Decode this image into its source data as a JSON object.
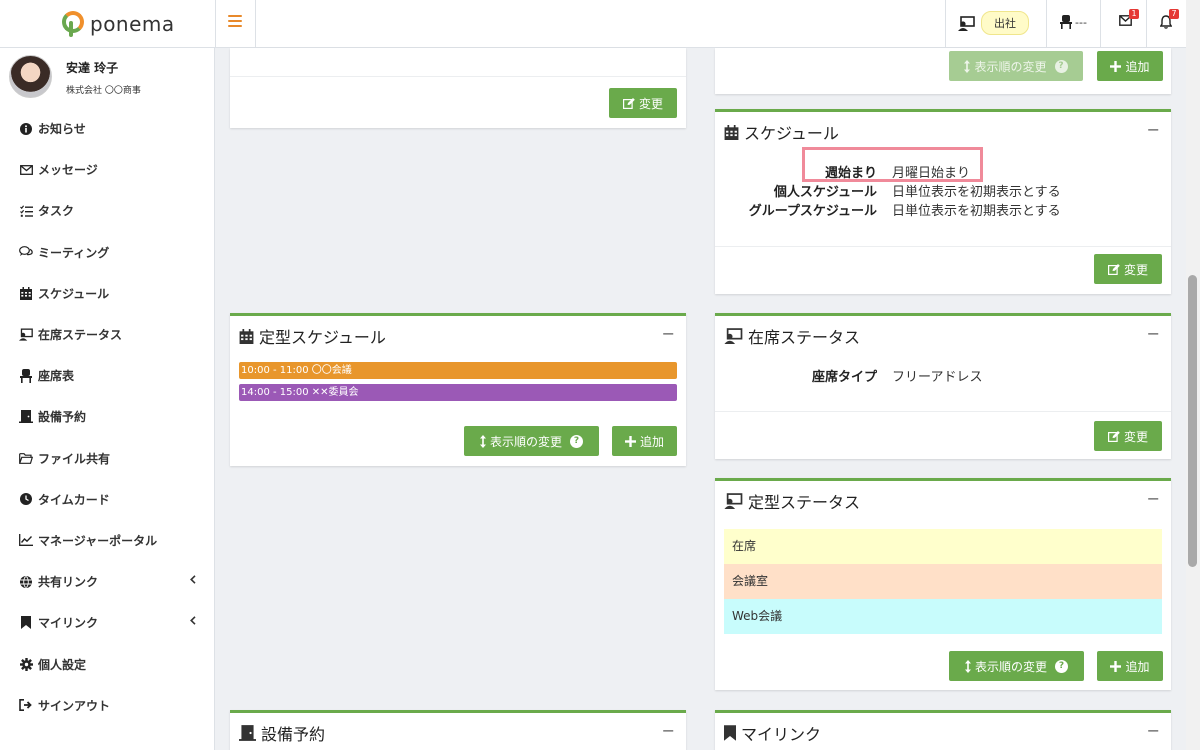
{
  "app": {
    "name": "ponema"
  },
  "topbar": {
    "attendance_label": "出社",
    "seat_label": "---",
    "mail_count": "1",
    "notification_count": "7",
    "icons": [
      "menu-icon",
      "attendance-icon",
      "seat-icon",
      "mail-icon",
      "bell-icon"
    ]
  },
  "user": {
    "name": "安達 玲子",
    "company": "株式会社 〇〇商事"
  },
  "sidebar": {
    "items": [
      {
        "label": "お知らせ",
        "icon": "info-icon"
      },
      {
        "label": "メッセージ",
        "icon": "envelope-icon"
      },
      {
        "label": "タスク",
        "icon": "checklist-icon"
      },
      {
        "label": "ミーティング",
        "icon": "chat-icon"
      },
      {
        "label": "スケジュール",
        "icon": "calendar-icon"
      },
      {
        "label": "在席ステータス",
        "icon": "attendance-icon"
      },
      {
        "label": "座席表",
        "icon": "chair-icon"
      },
      {
        "label": "設備予約",
        "icon": "door-icon"
      },
      {
        "label": "ファイル共有",
        "icon": "folder-icon"
      },
      {
        "label": "タイムカード",
        "icon": "clock-icon"
      },
      {
        "label": "マネージャーポータル",
        "icon": "chart-icon"
      },
      {
        "label": "共有リンク",
        "icon": "globe-icon",
        "has_submenu": true
      },
      {
        "label": "マイリンク",
        "icon": "bookmark-icon",
        "has_submenu": true
      },
      {
        "label": "個人設定",
        "icon": "cog-icon"
      },
      {
        "label": "サインアウト",
        "icon": "signout-icon"
      }
    ]
  },
  "panels": {
    "top_left": {
      "edit_label": "変更"
    },
    "top_right": {
      "reorder_label": "表示順の変更",
      "add_label": "追加"
    },
    "schedule": {
      "title": "スケジュール",
      "rows": [
        {
          "key": "週始まり",
          "value": "月曜日始まり"
        },
        {
          "key": "個人スケジュール",
          "value": "日単位表示を初期表示とする"
        },
        {
          "key": "グループスケジュール",
          "value": "日単位表示を初期表示とする"
        }
      ],
      "edit_label": "変更"
    },
    "fixed_schedule": {
      "title": "定型スケジュール",
      "entries": [
        {
          "text": "10:00 - 11:00  〇〇会議",
          "color": "#e8962c"
        },
        {
          "text": "14:00 - 15:00  ✕✕委員会",
          "color": "#9b59b6"
        }
      ],
      "reorder_label": "表示順の変更",
      "add_label": "追加"
    },
    "presence": {
      "title": "在席ステータス",
      "rows": [
        {
          "key": "座席タイプ",
          "value": "フリーアドレス"
        }
      ],
      "edit_label": "変更"
    },
    "fixed_status": {
      "title": "定型ステータス",
      "entries": [
        {
          "label": "在席",
          "color": "#ffffcc"
        },
        {
          "label": "会議室",
          "color": "#ffe0c8"
        },
        {
          "label": "Web会議",
          "color": "#c8fcfc"
        }
      ],
      "reorder_label": "表示順の変更",
      "add_label": "追加"
    },
    "facility": {
      "title": "設備予約"
    },
    "mylink": {
      "title": "マイリンク"
    }
  },
  "colors": {
    "accent": "#6aaa4b",
    "highlight": "#f08a9a",
    "menu": "#e8892b"
  }
}
